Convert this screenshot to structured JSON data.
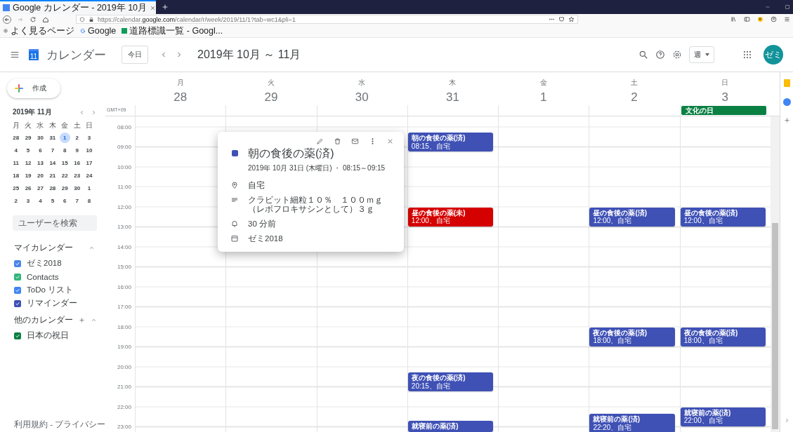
{
  "browser": {
    "tab_title": "Google カレンダー - 2019年 10月",
    "url": "https://calendar.**google.com**/calendar/r/week/2019/11/1?tab=wc1&pli=1",
    "bookmarks": [
      "よく見るページ",
      "Google",
      "道路標識一覧 - Googl..."
    ]
  },
  "header": {
    "logo_day": "11",
    "title": "カレンダー",
    "today_button": "今日",
    "range": "2019年 10月 ～ 11月",
    "view": "週",
    "avatar": "ゼミ"
  },
  "sidebar": {
    "create": "作成",
    "mini_calendar": {
      "title": "2019年 11月",
      "weekdays": [
        "月",
        "火",
        "水",
        "木",
        "金",
        "土",
        "日"
      ],
      "days": [
        {
          "label": "28",
          "selected": false
        },
        {
          "label": "29",
          "selected": false
        },
        {
          "label": "30",
          "selected": false
        },
        {
          "label": "31",
          "selected": false
        },
        {
          "label": "1",
          "selected": true
        },
        {
          "label": "2",
          "selected": false
        },
        {
          "label": "3",
          "selected": false
        },
        {
          "label": "4",
          "selected": false
        },
        {
          "label": "5",
          "selected": false
        },
        {
          "label": "6",
          "selected": false
        },
        {
          "label": "7",
          "selected": false
        },
        {
          "label": "8",
          "selected": false
        },
        {
          "label": "9",
          "selected": false
        },
        {
          "label": "10",
          "selected": false
        },
        {
          "label": "11",
          "selected": false
        },
        {
          "label": "12",
          "selected": false
        },
        {
          "label": "13",
          "selected": false
        },
        {
          "label": "14",
          "selected": false
        },
        {
          "label": "15",
          "selected": false
        },
        {
          "label": "16",
          "selected": false
        },
        {
          "label": "17",
          "selected": false
        },
        {
          "label": "18",
          "selected": false
        },
        {
          "label": "19",
          "selected": false
        },
        {
          "label": "20",
          "selected": false
        },
        {
          "label": "21",
          "selected": false
        },
        {
          "label": "22",
          "selected": false
        },
        {
          "label": "23",
          "selected": false
        },
        {
          "label": "24",
          "selected": false
        },
        {
          "label": "25",
          "selected": false
        },
        {
          "label": "26",
          "selected": false
        },
        {
          "label": "27",
          "selected": false
        },
        {
          "label": "28",
          "selected": false
        },
        {
          "label": "29",
          "selected": false
        },
        {
          "label": "30",
          "selected": false
        },
        {
          "label": "1",
          "selected": false
        },
        {
          "label": "2",
          "selected": false
        },
        {
          "label": "3",
          "selected": false
        },
        {
          "label": "4",
          "selected": false
        },
        {
          "label": "5",
          "selected": false
        },
        {
          "label": "6",
          "selected": false
        },
        {
          "label": "7",
          "selected": false
        },
        {
          "label": "8",
          "selected": false
        }
      ]
    },
    "search_placeholder": "ユーザーを検索",
    "my_calendars": {
      "title": "マイカレンダー",
      "items": [
        {
          "label": "ゼミ2018",
          "checked": true,
          "color": "#4a86e8"
        },
        {
          "label": "Contacts",
          "checked": true,
          "color": "#33b679"
        },
        {
          "label": "ToDo リスト",
          "checked": true,
          "color": "#4285f4"
        },
        {
          "label": "リマインダー",
          "checked": true,
          "color": "#3f51b5"
        }
      ]
    },
    "other_calendars": {
      "title": "他のカレンダー",
      "items": [
        {
          "label": "日本の祝日",
          "checked": true,
          "color": "#0b8043"
        }
      ]
    },
    "footer": "利用規約 - プライバシー"
  },
  "week": {
    "timezone": "GMT+09",
    "hours": [
      "08:00",
      "09:00",
      "10:00",
      "11:00",
      "12:00",
      "13:00",
      "14:00",
      "15:00",
      "16:00",
      "17:00",
      "18:00",
      "19:00",
      "20:00",
      "21:00",
      "22:00",
      "23:00"
    ],
    "days": [
      {
        "weekday": "月",
        "date": "28"
      },
      {
        "weekday": "火",
        "date": "29"
      },
      {
        "weekday": "水",
        "date": "30"
      },
      {
        "weekday": "木",
        "date": "31",
        "events": [
          {
            "title": "朝の食後の薬(済)",
            "subtitle": "08:15、自宅",
            "color": "#3f51b5"
          },
          {
            "title": "昼の食後の薬(未)",
            "subtitle": "12:00、自宅",
            "color": "#d50000"
          },
          {
            "title": "夜の食後の薬(済)",
            "subtitle": "20:15、自宅",
            "color": "#3f51b5"
          },
          {
            "title": "就寝前の薬(済)",
            "color": "#3f51b5"
          }
        ]
      },
      {
        "weekday": "金",
        "date": "1"
      },
      {
        "weekday": "土",
        "date": "2",
        "events": [
          {
            "title": "昼の食後の薬(済)",
            "subtitle": "12:00、自宅",
            "color": "#3f51b5"
          },
          {
            "title": "夜の食後の薬(済)",
            "subtitle": "18:00、自宅",
            "color": "#3f51b5"
          },
          {
            "title": "就寝前の薬(済)",
            "subtitle": "22:20、自宅",
            "color": "#3f51b5"
          }
        ]
      },
      {
        "weekday": "日",
        "date": "3",
        "all_day": [
          {
            "title": "文化の日",
            "color": "#0b8043"
          }
        ],
        "events": [
          {
            "title": "昼の食後の薬(済)",
            "subtitle": "12:00、自宅",
            "color": "#3f51b5"
          },
          {
            "title": "夜の食後の薬(済)",
            "subtitle": "18:00、自宅",
            "color": "#3f51b5"
          },
          {
            "title": "就寝前の薬(済)",
            "subtitle": "22:00、自宅",
            "color": "#3f51b5"
          }
        ]
      }
    ]
  },
  "popup": {
    "title": "朝の食後の薬(済)",
    "color": "#3f51b5",
    "when": "2019年 10月 31日 (木曜日) ・ 08:15～09:15",
    "location": "自宅",
    "description": "クラビット細粒１０％　１００ｍｇ（レボフロキサシンとして）３ｇ",
    "reminder": "30 分前",
    "calendar": "ゼミ2018"
  }
}
